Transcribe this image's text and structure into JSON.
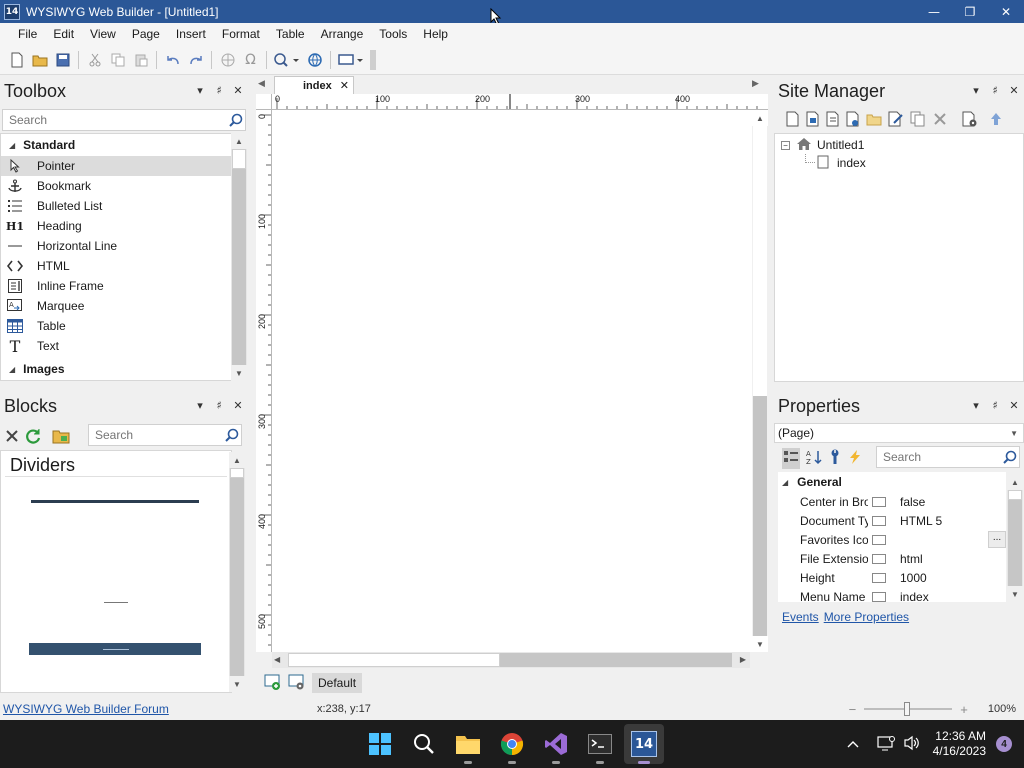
{
  "window": {
    "title": "WYSIWYG Web Builder - [Untitled1]",
    "app_badge": "14"
  },
  "menu": [
    "File",
    "Edit",
    "View",
    "Page",
    "Insert",
    "Format",
    "Table",
    "Arrange",
    "Tools",
    "Help"
  ],
  "toolbox": {
    "title": "Toolbox",
    "search_placeholder": "Search",
    "group_standard": "Standard",
    "items": [
      {
        "label": "Pointer",
        "icon": "pointer-icon"
      },
      {
        "label": "Bookmark",
        "icon": "anchor-icon"
      },
      {
        "label": "Bulleted List",
        "icon": "bulleted-list-icon"
      },
      {
        "label": "Heading",
        "icon": "heading-icon",
        "glyph": "H1"
      },
      {
        "label": "Horizontal Line",
        "icon": "horizontal-line-icon"
      },
      {
        "label": "HTML",
        "icon": "code-icon"
      },
      {
        "label": "Inline Frame",
        "icon": "inline-frame-icon"
      },
      {
        "label": "Marquee",
        "icon": "marquee-icon"
      },
      {
        "label": "Table",
        "icon": "table-icon"
      },
      {
        "label": "Text",
        "icon": "text-icon",
        "glyph": "T"
      }
    ],
    "group_images": "Images"
  },
  "blocks": {
    "title": "Blocks",
    "search_placeholder": "Search",
    "category": "Dividers"
  },
  "editor": {
    "tab_label": "index",
    "ruler_h": [
      "0",
      "100",
      "200",
      "300",
      "400"
    ],
    "ruler_v": [
      "0",
      "100",
      "200",
      "300",
      "400",
      "500"
    ],
    "bottom_tab": "Default"
  },
  "site_manager": {
    "title": "Site Manager",
    "root": "Untitled1",
    "page": "index"
  },
  "properties": {
    "title": "Properties",
    "selector": "(Page)",
    "search_placeholder": "Search",
    "group": "General",
    "rows": [
      {
        "name": "Center in Bro...",
        "value": "false"
      },
      {
        "name": "Document Ty...",
        "value": "HTML 5"
      },
      {
        "name": "Favorites Icon",
        "value": ""
      },
      {
        "name": "File Extension",
        "value": "html"
      },
      {
        "name": "Height",
        "value": "1000"
      },
      {
        "name": "Menu Name",
        "value": "index"
      }
    ],
    "browse_label": "...",
    "link_events": "Events",
    "link_more": "More Properties"
  },
  "status": {
    "forum_link": "WYSIWYG Web Builder Forum",
    "coords": "x:238, y:17",
    "zoom_minus": "−",
    "zoom_plus": "+",
    "zoom": "100%"
  },
  "taskbar": {
    "time": "12:36 AM",
    "date": "4/16/2023",
    "notifications": "4",
    "wb_badge": "14"
  },
  "colors": {
    "titlebar": "#2b5797",
    "accent_link": "#2056a8",
    "taskbar": "#1c1c1c"
  }
}
